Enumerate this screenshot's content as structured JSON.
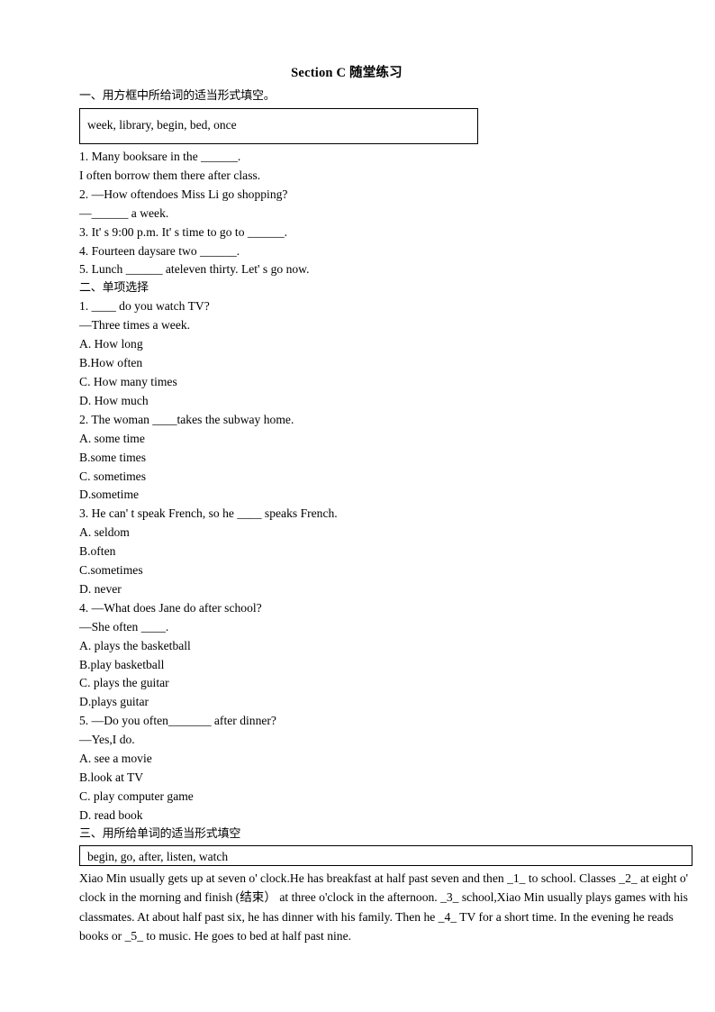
{
  "document": {
    "title": "Section C  随堂练习"
  },
  "section_one": {
    "heading": "一、用方框中所给词的适当形式填空。",
    "word_bank": "week,  library,  begin,  bed,  once",
    "items": [
      "1. Many booksare in the ______.",
      "I often borrow them there after class.",
      "2. —How oftendoes Miss Li go shopping?",
      "—______ a week.",
      "3. It' s 9:00 p.m. It' s time to go to ______.",
      "4. Fourteen daysare two ______.",
      "5. Lunch ______ ateleven thirty. Let' s go now."
    ]
  },
  "section_two": {
    "heading": "二、单项选择",
    "items": [
      "1. ____ do you watch TV?",
      "—Three times a week.",
      "A.  How long",
      "B.How often",
      "C. How many times",
      "D. How much",
      "2. The woman ____takes the subway home.",
      "A.  some time",
      "B.some times",
      "C. sometimes",
      "D.sometime",
      "3. He can' t speak French, so he ____ speaks French.",
      "A.  seldom",
      "B.often",
      "C.sometimes",
      "D. never",
      "4. —What does Jane do after school?",
      "—She often ____.",
      "A.  plays the basketball",
      "B.play basketball",
      "C. plays the guitar",
      "D.plays guitar",
      "5. —Do you often_______ after dinner?",
      "—Yes,I do.",
      "A.  see a movie",
      "B.look at TV",
      "C. play computer game",
      "D. read book"
    ]
  },
  "section_three": {
    "heading": "三、用所给单词的适当形式填空",
    "word_bank": "begin,  go, after, listen, watch",
    "passage": "Xiao Min usually gets up at seven o' clock.He has breakfast at half past seven and then _1_ to school. Classes _2_ at eight o' clock in the morning and finish (结束） at three o'clock in the afternoon. _3_ school,Xiao Min usually plays games with his classmates. At about half past six, he has dinner with his family.  Then he _4_ TV for a short time. In the evening he reads books or _5_ to music. He goes to bed at half past nine."
  }
}
